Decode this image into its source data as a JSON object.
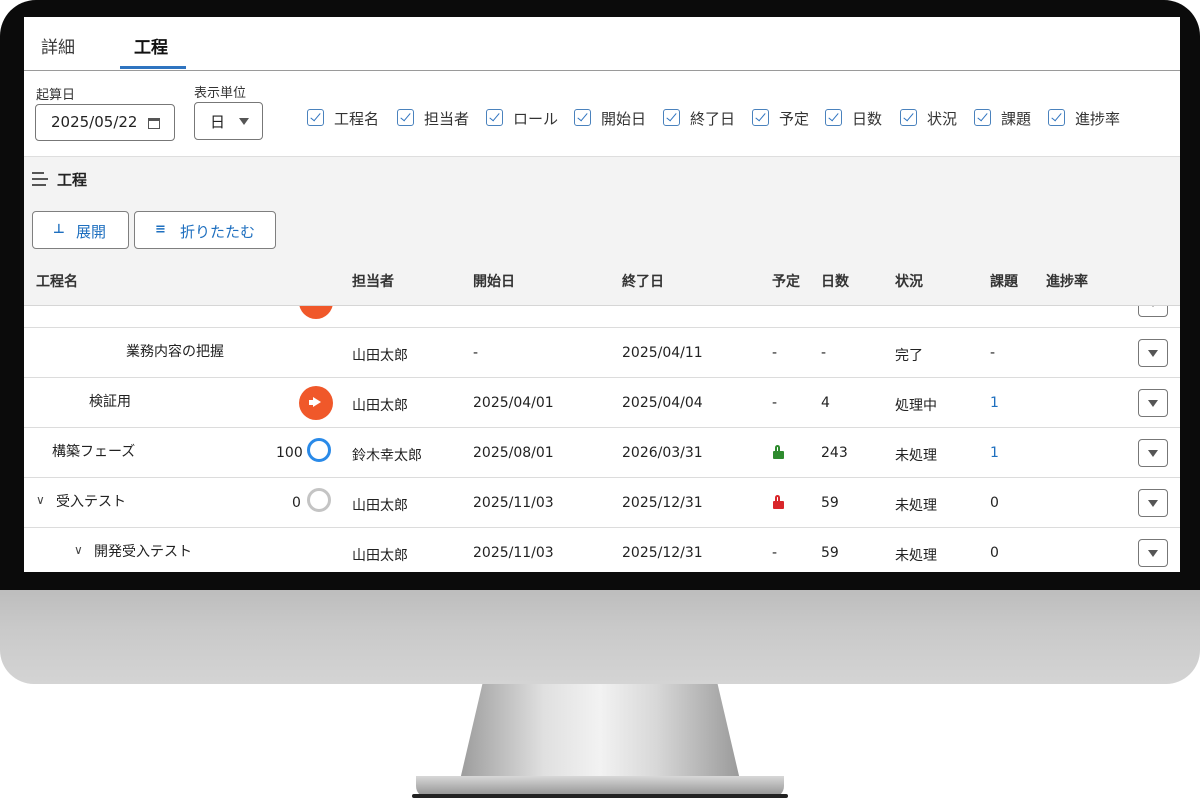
{
  "tabs": [
    {
      "label": "詳細",
      "active": false
    },
    {
      "label": "工程",
      "active": true
    }
  ],
  "filters": {
    "start_date_label": "起算日",
    "start_date_value": "2025/05/22",
    "unit_label": "表示単位",
    "unit_value": "日",
    "columns": [
      {
        "label": "工程名",
        "checked": true
      },
      {
        "label": "担当者",
        "checked": true
      },
      {
        "label": "ロール",
        "checked": true
      },
      {
        "label": "開始日",
        "checked": true
      },
      {
        "label": "終了日",
        "checked": true
      },
      {
        "label": "予定",
        "checked": true
      },
      {
        "label": "日数",
        "checked": true
      },
      {
        "label": "状況",
        "checked": true
      },
      {
        "label": "課題",
        "checked": true
      },
      {
        "label": "進捗率",
        "checked": true
      }
    ]
  },
  "section": {
    "title": "工程",
    "icon": "list-icon"
  },
  "actions": {
    "expand_label": "展開",
    "collapse_label": "折りたたむ"
  },
  "table": {
    "headers": [
      "工程名",
      "担当者",
      "開始日",
      "終了日",
      "予定",
      "日数",
      "状況",
      "課題",
      "進捗率"
    ],
    "rows": [
      {
        "name": "業務内容の把握",
        "indent": 3,
        "chevron": false,
        "badge": "",
        "progress": "",
        "assignee": "山田太郎",
        "start": "-",
        "end": "2025/04/11",
        "plan": "-",
        "days": "-",
        "status": "完了",
        "issues": "-",
        "issues_link": false
      },
      {
        "name": "検証用",
        "indent": 2,
        "chevron": false,
        "badge": "megaphone",
        "progress": "",
        "assignee": "山田太郎",
        "start": "2025/04/01",
        "end": "2025/04/04",
        "plan": "-",
        "days": "4",
        "status": "処理中",
        "issues": "1",
        "issues_link": true
      },
      {
        "name": "構築フェーズ",
        "indent": 1,
        "chevron": false,
        "badge": "ring",
        "progress": "100",
        "assignee": "鈴木幸太郎",
        "start": "2025/08/01",
        "end": "2026/03/31",
        "plan": "unlocked",
        "days": "243",
        "status": "未処理",
        "issues": "1",
        "issues_link": true
      },
      {
        "name": "受入テスト",
        "indent": 0,
        "chevron": true,
        "badge": "ring",
        "progress": "0",
        "assignee": "山田太郎",
        "start": "2025/11/03",
        "end": "2025/12/31",
        "plan": "locked",
        "days": "59",
        "status": "未処理",
        "issues": "0",
        "issues_link": false
      },
      {
        "name": "開発受入テスト",
        "indent": 1,
        "chevron": true,
        "badge": "",
        "progress": "",
        "assignee": "山田太郎",
        "start": "2025/11/03",
        "end": "2025/12/31",
        "plan": "-",
        "days": "59",
        "status": "未処理",
        "issues": "0",
        "issues_link": false
      }
    ]
  },
  "colors": {
    "accent": "#2f74c0",
    "badge_orange": "#f0582a",
    "ring_blue": "#2a8ae8",
    "ring_gray": "#c4c4c4",
    "lock_green": "#2e8b2e",
    "lock_red": "#d9262a"
  }
}
